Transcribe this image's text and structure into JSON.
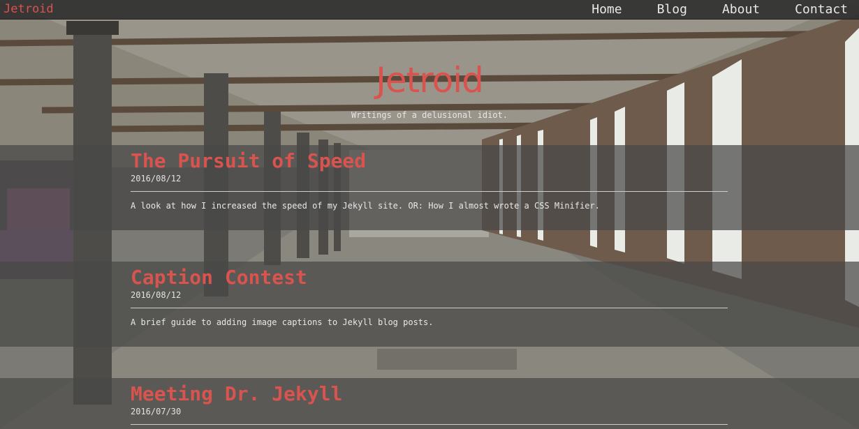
{
  "site": {
    "logo": "Jetroid",
    "nav": [
      "Home",
      "Blog",
      "About",
      "Contact"
    ]
  },
  "hero": {
    "title": "Jetroid",
    "subtitle": "Writings of a delusional idiot."
  },
  "posts": [
    {
      "title": "The Pursuit of Speed",
      "date": "2016/08/12",
      "excerpt": "A look at how I increased the speed of my Jekyll site. OR: How I almost wrote a CSS Minifier."
    },
    {
      "title": "Caption Contest",
      "date": "2016/08/12",
      "excerpt": "A brief guide to adding image captions to Jekyll blog posts."
    },
    {
      "title": "Meeting Dr. Jekyll",
      "date": "2016/07/30",
      "excerpt": ""
    }
  ],
  "colors": {
    "accent": "#d9534f",
    "bar": "#303030",
    "text": "#e8e8e8"
  }
}
